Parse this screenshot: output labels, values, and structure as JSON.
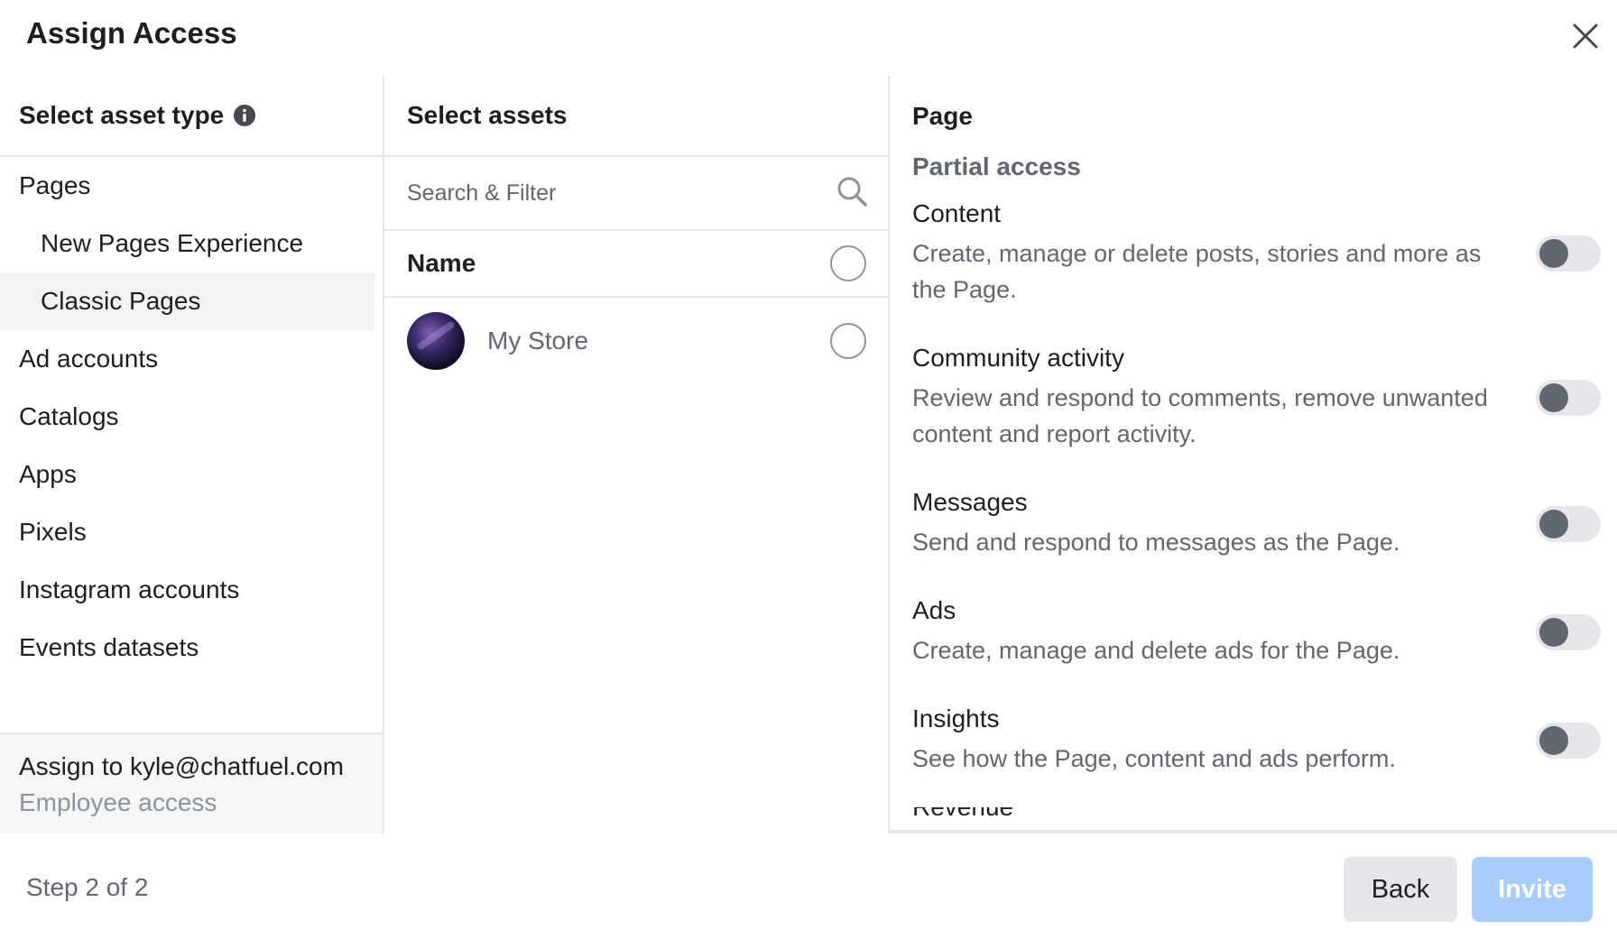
{
  "dialog": {
    "title": "Assign Access",
    "close_icon": "close-icon"
  },
  "left_column": {
    "heading": "Select asset type",
    "heading_icon": "info-icon",
    "items": [
      {
        "label": "Pages",
        "level": 0,
        "selected": false
      },
      {
        "label": "New Pages Experience",
        "level": 1,
        "selected": false
      },
      {
        "label": "Classic Pages",
        "level": 1,
        "selected": true
      },
      {
        "label": "Ad accounts",
        "level": 0,
        "selected": false
      },
      {
        "label": "Catalogs",
        "level": 0,
        "selected": false
      },
      {
        "label": "Apps",
        "level": 0,
        "selected": false
      },
      {
        "label": "Pixels",
        "level": 0,
        "selected": false
      },
      {
        "label": "Instagram accounts",
        "level": 0,
        "selected": false
      },
      {
        "label": "Events datasets",
        "level": 0,
        "selected": false
      }
    ],
    "assign": {
      "to": "Assign to kyle@chatfuel.com",
      "role": "Employee access"
    }
  },
  "middle_column": {
    "heading": "Select assets",
    "search": {
      "placeholder": "Search & Filter",
      "value": "",
      "icon": "search-icon"
    },
    "name_header": "Name",
    "assets": [
      {
        "name": "My Store",
        "selected": false
      }
    ]
  },
  "right_column": {
    "heading": "Page",
    "subheading": "Partial access",
    "permissions": [
      {
        "title": "Content",
        "description": "Create, manage or delete posts, stories and more as the Page.",
        "enabled": false
      },
      {
        "title": "Community activity",
        "description": "Review and respond to comments, remove unwanted content and report activity.",
        "enabled": false
      },
      {
        "title": "Messages",
        "description": "Send and respond to messages as the Page.",
        "enabled": false
      },
      {
        "title": "Ads",
        "description": "Create, manage and delete ads for the Page.",
        "enabled": false
      },
      {
        "title": "Insights",
        "description": "See how the Page, content and ads perform.",
        "enabled": false
      }
    ],
    "cut_off_item": "Revenue"
  },
  "footer": {
    "step": "Step 2 of 2",
    "back_label": "Back",
    "invite_label": "Invite"
  },
  "colors": {
    "primary_disabled": "#a7cdfa",
    "selected_bg": "#f2f3f5",
    "toggle_off_track": "#e4e6eb",
    "toggle_off_knob": "#606770"
  }
}
